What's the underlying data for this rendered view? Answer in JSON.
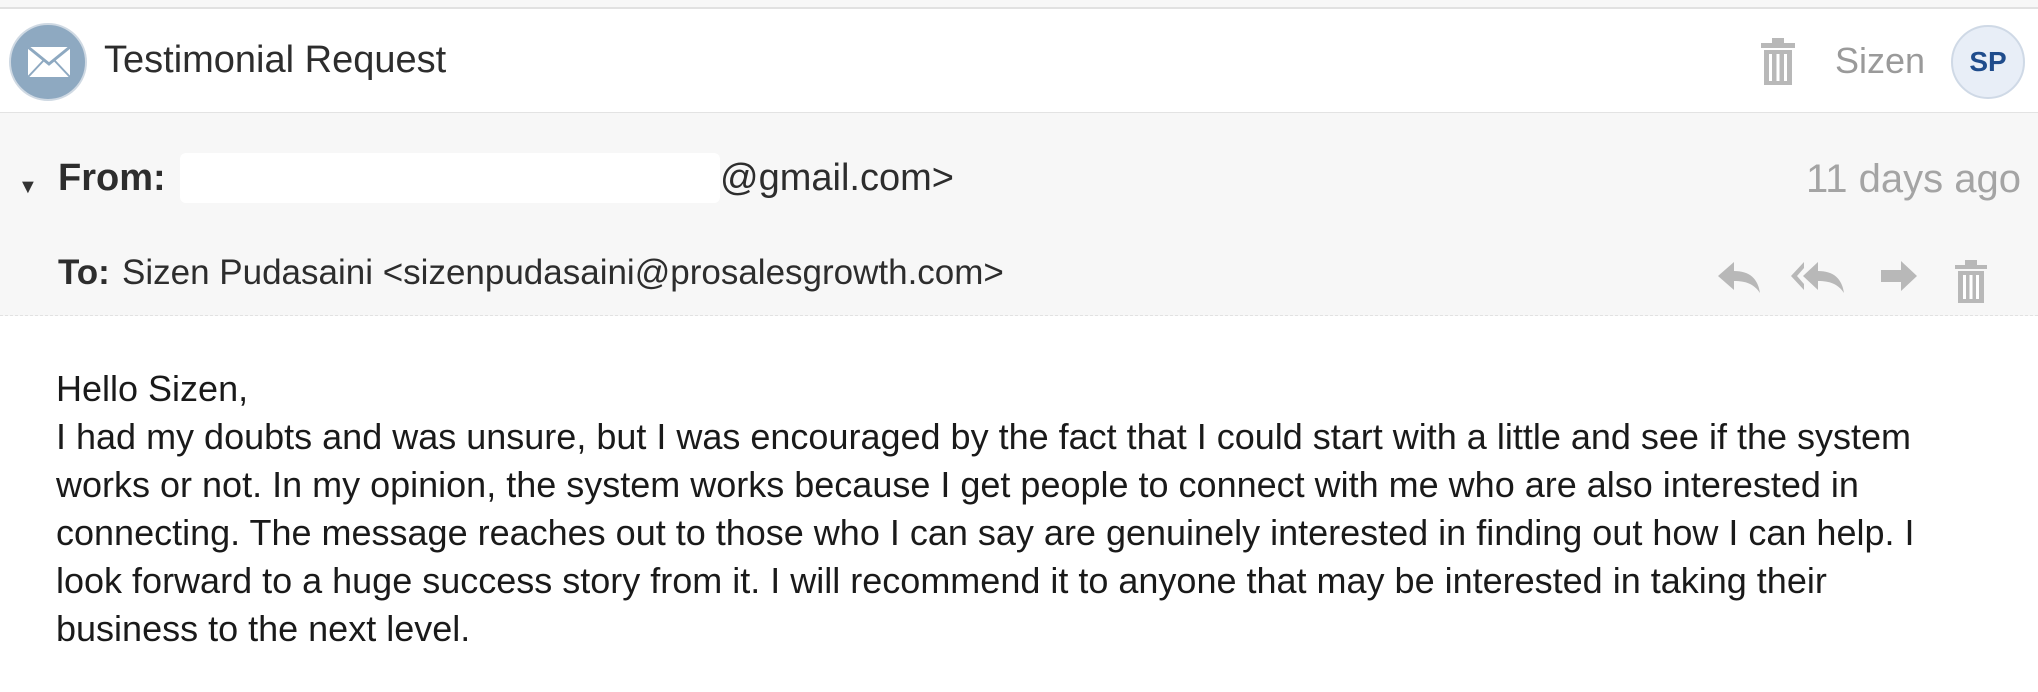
{
  "header": {
    "subject": "Testimonial Request",
    "user_name": "Sizen",
    "user_initials": "SP",
    "icons": [
      "mail-icon",
      "trash-icon"
    ]
  },
  "message": {
    "from_label": "From:",
    "from_visible": "@gmail.com>",
    "to_label": "To:",
    "to_value": "Sizen Pudasaini <sizenpudasaini@prosalesgrowth.com>",
    "date": "11 days ago",
    "actions": [
      "reply-icon",
      "reply-all-icon",
      "forward-icon",
      "trash-icon"
    ]
  },
  "body": {
    "greeting": "Hello Sizen,",
    "text": "I had my doubts and was unsure, but I was encouraged by the fact that I could start with a little and see if the system works or not. In my opinion, the system works because I get people to connect with me who are also interested in connecting. The message reaches out to those who I can say are genuinely interested in finding out how I can help. I look forward to a huge success story from it. I will recommend it to anyone that may be interested in taking their business to the next level."
  },
  "colors": {
    "accent": "#1f4c8c",
    "avatar": "#8ea9c1",
    "meta_background": "#f7f7f7",
    "muted": "#a4a4a4"
  }
}
